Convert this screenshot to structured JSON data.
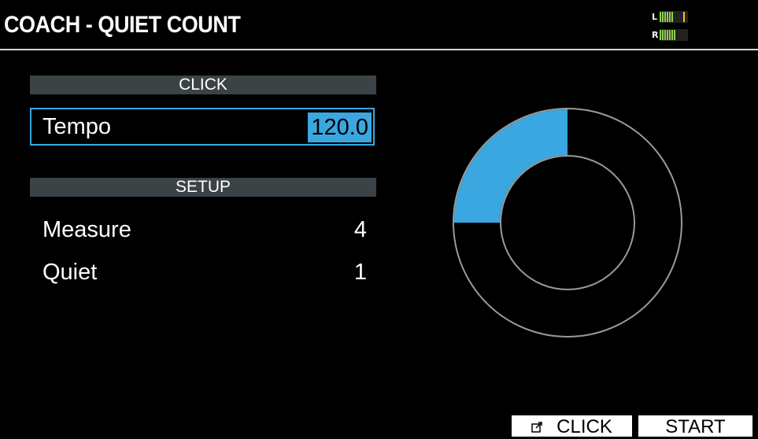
{
  "header": {
    "title": "COACH - QUIET COUNT",
    "meter": {
      "left_label": "L",
      "right_label": "R",
      "left_level": 0.6,
      "right_level": 0.7,
      "peak_hold_left": 0.82
    }
  },
  "click_section": {
    "title": "CLICK",
    "tempo": {
      "label": "Tempo",
      "value": "120.0"
    }
  },
  "setup_section": {
    "title": "SETUP",
    "measure": {
      "label": "Measure",
      "value": "4"
    },
    "quiet": {
      "label": "Quiet",
      "value": "1"
    }
  },
  "progress_ring": {
    "progress_fraction": 0.25,
    "fill_color": "#3aa7e0",
    "track_color": "#000000",
    "outline_color": "#9a9a9a"
  },
  "function_buttons": {
    "click_label": "CLICK",
    "start_label": "START"
  },
  "colors": {
    "accent": "#3aa7e0",
    "header_bar": "#3c4346",
    "meter_green": "#8fd14f",
    "meter_peak": "#f2c21b"
  }
}
